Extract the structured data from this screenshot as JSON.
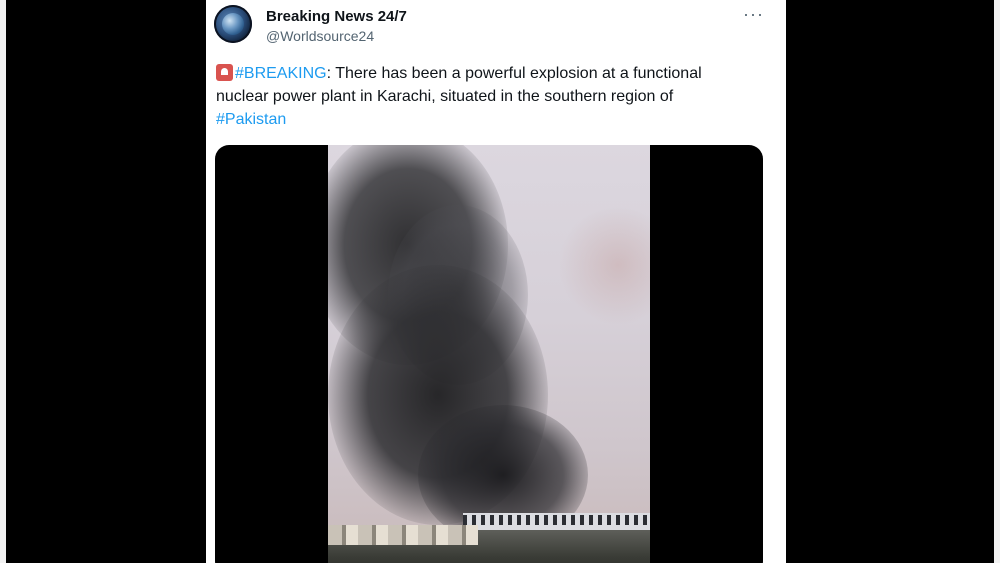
{
  "tweet": {
    "display_name": "Breaking News 24/7",
    "handle": "@Worldsource24",
    "more_label": "···",
    "text": {
      "emoji": "siren-icon",
      "hashtag_1": "#BREAKING",
      "body": ": There has been a powerful explosion at a functional nuclear power plant in Karachi, situated in the southern region of",
      "hashtag_2": "#Pakistan"
    }
  },
  "colors": {
    "link": "#1d9bf0",
    "text": "#0f1419",
    "secondary": "#536471"
  }
}
